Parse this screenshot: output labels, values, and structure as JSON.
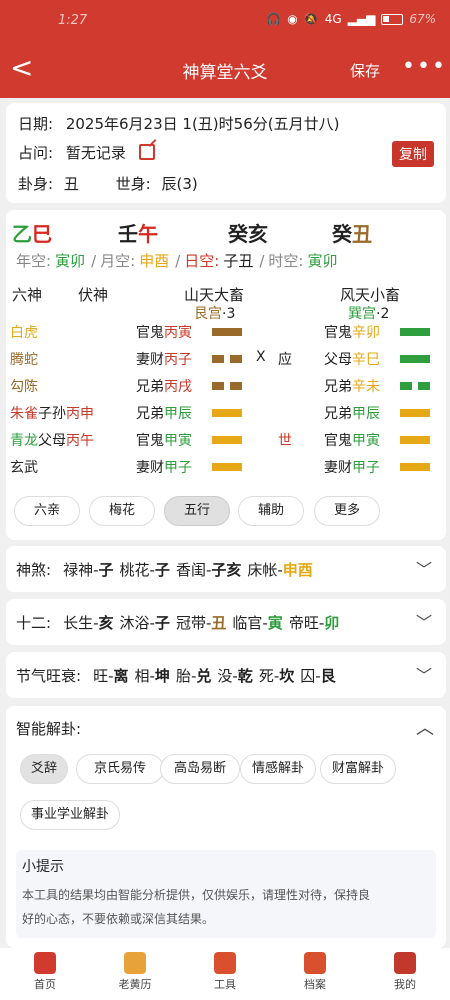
{
  "status": {
    "time": "1:27",
    "battery": "67%",
    "signal": "4G"
  },
  "nav": {
    "title": "神算堂六爻",
    "save": "保存",
    "more": "•••",
    "back": "<"
  },
  "info": {
    "date_label": "日期:",
    "date_value": "2025年6月23日 1(丑)时56分(五月廿八)",
    "ask_label": "占问:",
    "ask_value": "暂无记录",
    "copy": "复制",
    "guashen_label": "卦身:",
    "guashen_value": "丑",
    "shishen_label": "世身:",
    "shishen_value": "辰(3)"
  },
  "chart": {
    "ganzhi": [
      {
        "gan": "乙",
        "zhi": "巳",
        "gan_color": "#2e9e3e",
        "zhi_color": "#d6281f"
      },
      {
        "gan": "壬",
        "zhi": "午",
        "gan_color": "#222222",
        "zhi_color": "#d6281f"
      },
      {
        "gan": "癸",
        "zhi": "亥",
        "gan_color": "#222222",
        "zhi_color": "#222222"
      },
      {
        "gan": "癸",
        "zhi": "丑",
        "gan_color": "#222222",
        "zhi_color": "#9a6a2a"
      }
    ],
    "kong": [
      {
        "label": "年空:",
        "value": "寅卯",
        "color": "#2e9e3e"
      },
      {
        "label": "月空:",
        "value": "申酉",
        "color": "#e6a817"
      },
      {
        "label": "日空:",
        "value": "子丑",
        "color": "#222222",
        "label_color": "#c83a2a"
      },
      {
        "label": "时空:",
        "value": "寅卯",
        "color": "#2e9e3e"
      }
    ],
    "headers": {
      "liushen": "六神",
      "fushen": "伏神"
    },
    "main_gua": {
      "name": "山天大畜",
      "palace": "艮宫",
      "num": "·3"
    },
    "change_gua": {
      "name": "风天小畜",
      "palace": "巽宫",
      "num": "·2"
    },
    "rows": [
      {
        "god": "白虎",
        "god_color": "#e6a817",
        "fu": "",
        "fu_zhi": "",
        "fu_color": "",
        "rel": "官鬼",
        "stem": "丙",
        "zhi": "寅",
        "sz_color": "#c83a2a",
        "yao": "solid",
        "yao_color": "#9a6a2a",
        "mark": "",
        "shiying": "",
        "c_rel": "官鬼",
        "c_stem": "辛",
        "c_zhi": "卯",
        "c_color": "#e6a817",
        "c_yao": "solid",
        "c_yao_color": "#2e9e3e"
      },
      {
        "god": "腾蛇",
        "god_color": "#9a6a2a",
        "fu": "",
        "fu_zhi": "",
        "fu_color": "",
        "rel": "妻财",
        "stem": "丙",
        "zhi": "子",
        "sz_color": "#c83a2a",
        "yao": "broken",
        "yao_color": "#9a6a2a",
        "mark": "X",
        "shiying": "应",
        "c_rel": "父母",
        "c_stem": "辛",
        "c_zhi": "巳",
        "c_color": "#e6a817",
        "c_yao": "solid",
        "c_yao_color": "#2e9e3e"
      },
      {
        "god": "勾陈",
        "god_color": "#9a6a2a",
        "fu": "",
        "fu_zhi": "",
        "fu_color": "",
        "rel": "兄弟",
        "stem": "丙",
        "zhi": "戌",
        "sz_color": "#c83a2a",
        "yao": "broken",
        "yao_color": "#9a6a2a",
        "mark": "",
        "shiying": "",
        "c_rel": "兄弟",
        "c_stem": "辛",
        "c_zhi": "未",
        "c_color": "#e6a817",
        "c_yao": "broken",
        "c_yao_color": "#2e9e3e"
      },
      {
        "god": "朱雀",
        "god_color": "#c83a2a",
        "fu": "子孙",
        "fu_zhi": "丙申",
        "fu_color": "#c83a2a",
        "rel": "兄弟",
        "stem": "甲",
        "zhi": "辰",
        "sz_color": "#2e9e3e",
        "yao": "solid",
        "yao_color": "#e6a817",
        "mark": "",
        "shiying": "",
        "c_rel": "兄弟",
        "c_stem": "甲",
        "c_zhi": "辰",
        "c_color": "#2e9e3e",
        "c_yao": "solid",
        "c_yao_color": "#e6a817"
      },
      {
        "god": "青龙",
        "god_color": "#2e9e3e",
        "fu": "父母",
        "fu_zhi": "丙午",
        "fu_color": "#c83a2a",
        "rel": "官鬼",
        "stem": "甲",
        "zhi": "寅",
        "sz_color": "#2e9e3e",
        "yao": "solid",
        "yao_color": "#e6a817",
        "mark": "",
        "shiying": "世",
        "c_rel": "官鬼",
        "c_stem": "甲",
        "c_zhi": "寅",
        "c_color": "#2e9e3e",
        "c_yao": "solid",
        "c_yao_color": "#e6a817"
      },
      {
        "god": "玄武",
        "god_color": "#222222",
        "fu": "",
        "fu_zhi": "",
        "fu_color": "",
        "rel": "妻财",
        "stem": "甲",
        "zhi": "子",
        "sz_color": "#2e9e3e",
        "yao": "solid",
        "yao_color": "#e6a817",
        "mark": "",
        "shiying": "",
        "c_rel": "妻财",
        "c_stem": "甲",
        "c_zhi": "子",
        "c_color": "#2e9e3e",
        "c_yao": "solid",
        "c_yao_color": "#e6a817"
      }
    ],
    "buttons": [
      "六亲",
      "梅花",
      "五行",
      "辅助",
      "更多"
    ],
    "active_button": 2
  },
  "shensha": {
    "label": "神煞:",
    "items": [
      {
        "name": "禄神-",
        "val": "子",
        "color": "#222222"
      },
      {
        "name": "桃花-",
        "val": "子",
        "color": "#222222"
      },
      {
        "name": "香闺-",
        "val": "子亥",
        "color": "#222222"
      },
      {
        "name": "床帐-",
        "val": "申酉",
        "color": "#e6a817"
      }
    ]
  },
  "twelve": {
    "label": "十二:",
    "items": [
      {
        "name": "长生-",
        "val": "亥",
        "color": "#222222"
      },
      {
        "name": "沐浴-",
        "val": "子",
        "color": "#222222"
      },
      {
        "name": "冠带-",
        "val": "丑",
        "color": "#9a6a2a"
      },
      {
        "name": "临官-",
        "val": "寅",
        "color": "#2e9e3e"
      },
      {
        "name": "帝旺-",
        "val": "卯",
        "color": "#2e9e3e"
      }
    ]
  },
  "jieqi": {
    "label": "节气旺衰:",
    "items": [
      {
        "name": "旺-",
        "val": "离",
        "color": "#222222"
      },
      {
        "name": "相-",
        "val": "坤",
        "color": "#222222"
      },
      {
        "name": "胎-",
        "val": "兑",
        "color": "#222222"
      },
      {
        "name": "没-",
        "val": "乾",
        "color": "#222222"
      },
      {
        "name": "死-",
        "val": "坎",
        "color": "#222222"
      },
      {
        "name": "囚-",
        "val": "艮",
        "color": "#222222"
      }
    ]
  },
  "ai": {
    "title": "智能解卦:",
    "tabs": [
      "爻辞",
      "京氏易传",
      "高岛易断",
      "情感解卦",
      "财富解卦",
      "事业学业解卦"
    ],
    "active_tab": 0,
    "tip_title": "小提示",
    "tip_text1": "本工具的结果均由智能分析提供，仅供娱乐，请理性对待，保持良",
    "tip_text2": "好的心态，不要依赖或深信其结果。"
  },
  "bottom_nav": [
    {
      "label": "首页",
      "icon": "home-icon",
      "color": "#d13a2f"
    },
    {
      "label": "老黄历",
      "icon": "almanac-icon",
      "color": "#e8a23a"
    },
    {
      "label": "工具",
      "icon": "toolbox-icon",
      "color": "#d8502e"
    },
    {
      "label": "档案",
      "icon": "archive-icon",
      "color": "#d8502e"
    },
    {
      "label": "我的",
      "icon": "profile-icon",
      "color": "#c0392b"
    }
  ]
}
